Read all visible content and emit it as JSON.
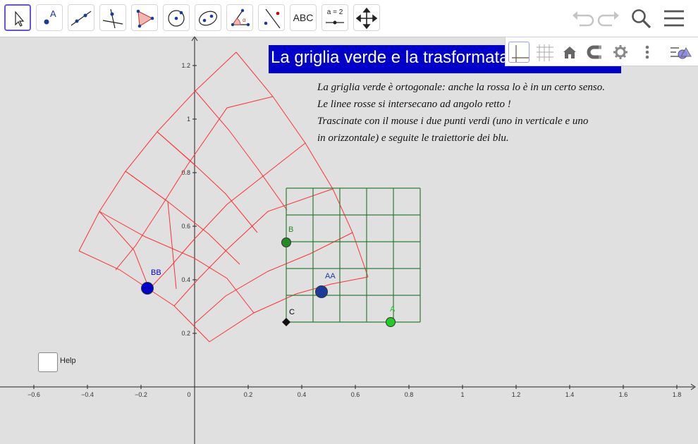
{
  "toolbar": {
    "tools": [
      {
        "name": "move-tool",
        "label": ""
      },
      {
        "name": "point-tool",
        "label": "A"
      },
      {
        "name": "line-tool",
        "label": ""
      },
      {
        "name": "perpendicular-tool",
        "label": ""
      },
      {
        "name": "polygon-tool",
        "label": ""
      },
      {
        "name": "circle-tool",
        "label": ""
      },
      {
        "name": "ellipse-tool",
        "label": ""
      },
      {
        "name": "angle-tool",
        "label": "α"
      },
      {
        "name": "reflect-tool",
        "label": ""
      },
      {
        "name": "text-tool",
        "label": "ABC"
      },
      {
        "name": "slider-tool",
        "label": "a = 2"
      },
      {
        "name": "move-view-tool",
        "label": ""
      }
    ]
  },
  "title": "La griglia verde e la trasformata",
  "instructions": [
    "La griglia verde è ortogonale: anche la rossa lo è in un certo senso.",
    "Le linee rosse si intersecano ad angolo retto !",
    "Trascinate con il mouse i due punti verdi (uno in verticale e uno",
    "in orizzontale) e seguite le traiettorie dei blu."
  ],
  "help_label": "Help",
  "axes": {
    "x_ticks": [
      "−0.6",
      "−0.4",
      "−0.2",
      "0",
      "0.2",
      "0.4",
      "0.6",
      "0.8",
      "1",
      "1.2",
      "1.4",
      "1.6",
      "1.8"
    ],
    "y_ticks": [
      "1.2",
      "1",
      "0.8",
      "0.6",
      "0.4",
      "0.2"
    ]
  },
  "points": {
    "A": {
      "label": "A",
      "color": "#22cc22"
    },
    "B": {
      "label": "B",
      "color": "#228B22"
    },
    "C": {
      "label": "C",
      "color": "#000000"
    },
    "AA": {
      "label": "AA",
      "color": "#1a3b9c"
    },
    "BB": {
      "label": "BB",
      "color": "#0000cc"
    }
  },
  "colors": {
    "grid_green": "#2e7d32",
    "grid_red": "#ff3030",
    "title_bg": "#0000c8",
    "accent": "#6557d2"
  }
}
